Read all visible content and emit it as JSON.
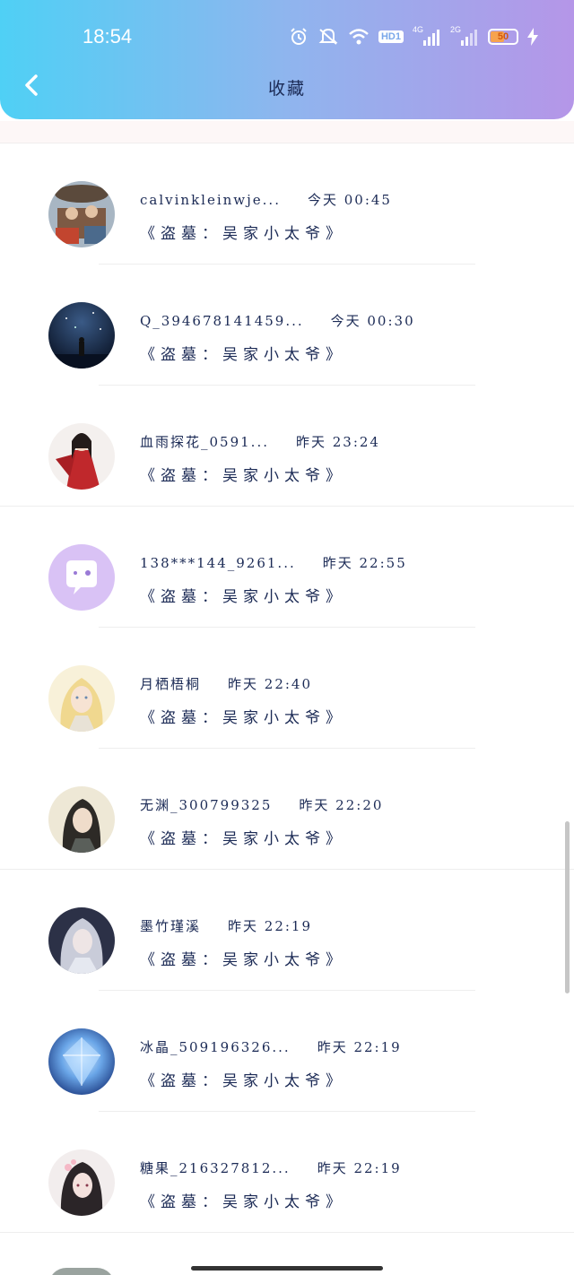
{
  "status_bar": {
    "time": "18:54",
    "icons": [
      "alarm-icon",
      "mute-icon",
      "wifi-icon",
      "hd-icon",
      "signal-4g-icon",
      "signal-2g-icon",
      "battery-icon",
      "charging-icon"
    ],
    "hd_label": "HD1",
    "net1": "4G",
    "net2": "2G",
    "battery": "50"
  },
  "header": {
    "title": "收藏",
    "back_icon": "chevron-left-icon"
  },
  "items": [
    {
      "name": "calvinkleinwje...",
      "time": "今天 00:45",
      "subtitle": "《盗墓：吴家小太爷》",
      "avatar": "anime-group-avatar"
    },
    {
      "name": "Q_394678141459...",
      "time": "今天 00:30",
      "subtitle": "《盗墓：吴家小太爷》",
      "avatar": "night-sky-avatar"
    },
    {
      "name": "血雨探花_0591...",
      "time": "昨天 23:24",
      "subtitle": "《盗墓：吴家小太爷》",
      "avatar": "red-robe-avatar"
    },
    {
      "name": "138***144_9261...",
      "time": "昨天 22:55",
      "subtitle": "《盗墓：吴家小太爷》",
      "avatar": "default-chat-avatar"
    },
    {
      "name": "月栖梧桐",
      "time": "昨天 22:40",
      "subtitle": "《盗墓：吴家小太爷》",
      "avatar": "blonde-girl-avatar"
    },
    {
      "name": "无渊_300799325",
      "time": "昨天 22:20",
      "subtitle": "《盗墓：吴家小太爷》",
      "avatar": "dark-hair-avatar"
    },
    {
      "name": "墨竹瑾溪",
      "time": "昨天 22:19",
      "subtitle": "《盗墓：吴家小太爷》",
      "avatar": "silver-hair-avatar"
    },
    {
      "name": "冰晶_509196326...",
      "time": "昨天 22:19",
      "subtitle": "《盗墓：吴家小太爷》",
      "avatar": "crystal-avatar"
    },
    {
      "name": "糖果_216327812...",
      "time": "昨天 22:19",
      "subtitle": "《盗墓：吴家小太爷》",
      "avatar": "flower-girl-avatar"
    }
  ]
}
